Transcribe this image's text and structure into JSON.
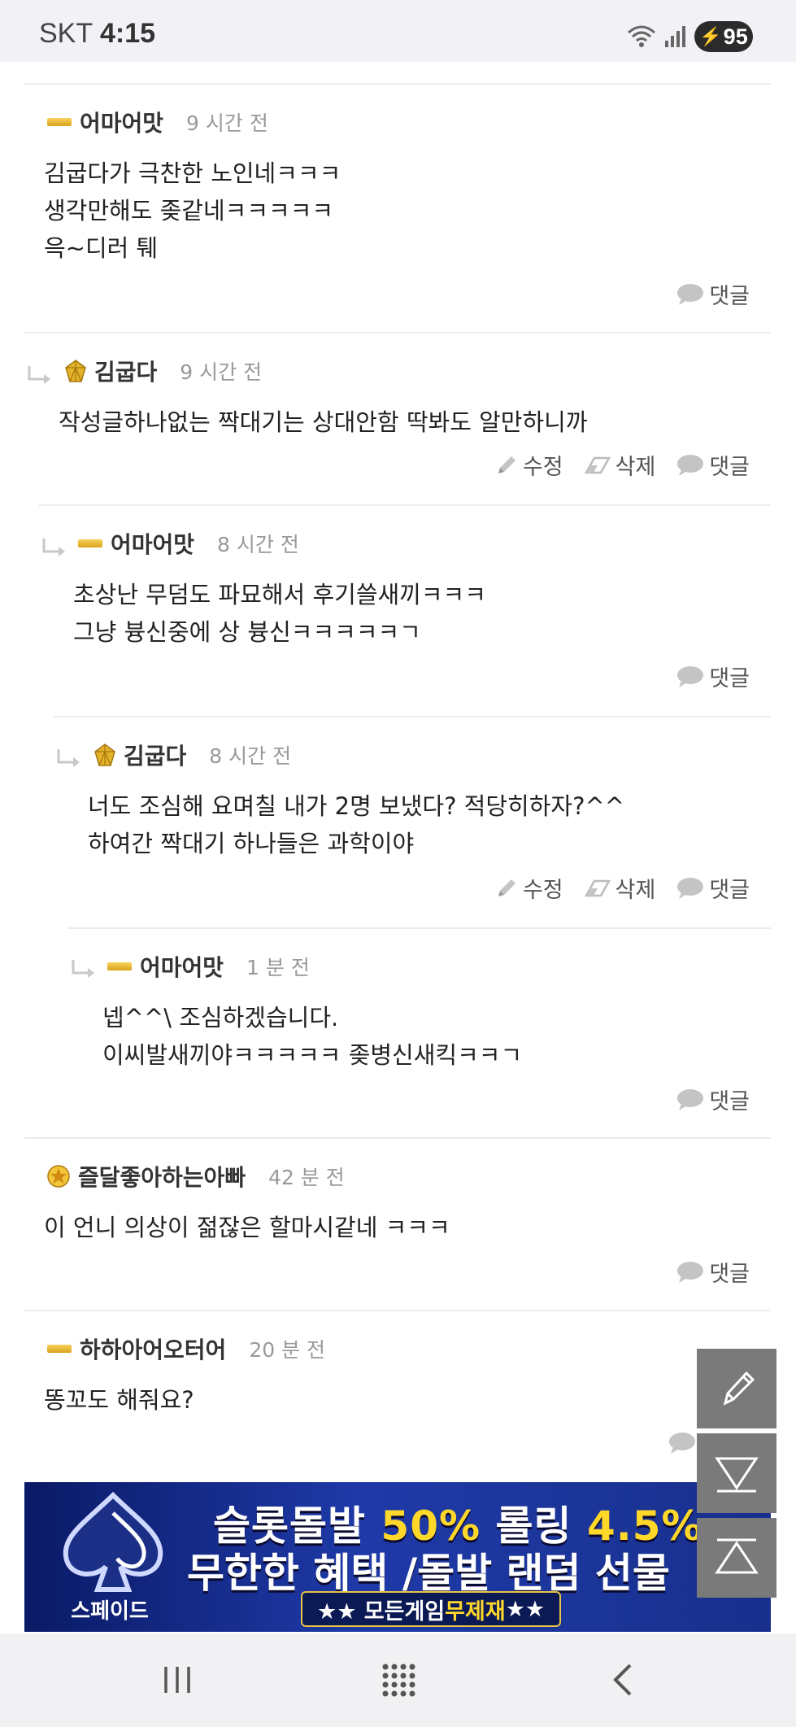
{
  "status_bar": {
    "carrier": "SKT",
    "time": "4:15",
    "battery": "95"
  },
  "comments": [
    {
      "nick": "어마어맛",
      "level_icon": "gold-bar-icon",
      "time": "9 시간 전",
      "lines": [
        "김굽다가 극찬한 노인네ㅋㅋㅋ",
        "생각만해도 좆같네ㅋㅋㅋㅋㅋ",
        "윽~디러 퉤"
      ],
      "actions": {
        "reply": "댓글"
      }
    },
    {
      "nick": "김굽다",
      "level_icon": "gold-gem-icon",
      "time": "9 시간 전",
      "lines": [
        "작성글하나없는 짝대기는 상대안함 딱봐도 알만하니까"
      ],
      "actions": {
        "edit": "수정",
        "delete": "삭제",
        "reply": "댓글"
      }
    },
    {
      "nick": "어마어맛",
      "level_icon": "gold-bar-icon",
      "time": "8 시간 전",
      "lines": [
        "초상난 무덤도 파묘해서 후기쓸새끼ㅋㅋㅋ",
        "그냥 븅신중에 상 븅신ㅋㅋㅋㅋㅋㄱ"
      ],
      "actions": {
        "reply": "댓글"
      }
    },
    {
      "nick": "김굽다",
      "level_icon": "gold-gem-icon",
      "time": "8 시간 전",
      "lines": [
        "너도 조심해 요며칠 내가 2명 보냈다? 적당히하자?^^",
        "하여간 짝대기 하나들은 과학이야"
      ],
      "actions": {
        "edit": "수정",
        "delete": "삭제",
        "reply": "댓글"
      }
    },
    {
      "nick": "어마어맛",
      "level_icon": "gold-bar-icon",
      "time": "1 분 전",
      "lines": [
        "넵^^\\ 조심하겠습니다.",
        "이씨발새끼야ㅋㅋㅋㅋㅋ 좆병신새킥ㅋㅋㄱ"
      ],
      "actions": {
        "reply": "댓글"
      }
    },
    {
      "nick": "즐달좋아하는아빠",
      "level_icon": "gold-star-icon",
      "time": "42 분 전",
      "lines": [
        "이 언니 의상이 젊잖은 할마시같네 ㅋㅋㅋ"
      ],
      "actions": {
        "reply": "댓글"
      }
    },
    {
      "nick": "하하아어오터어",
      "level_icon": "gold-bar-icon",
      "time": "20 분 전",
      "lines": [
        "똥꼬도 해줘요?"
      ],
      "actions": {}
    }
  ],
  "ad": {
    "brand": "스페이드",
    "line1_a": "슬롯돌발 ",
    "line1_b": "50%",
    "line1_c": " 롤링 ",
    "line1_d": "4.5%",
    "line2": "무한한 혜택 /돌발 랜덤 선물",
    "strip_a": "★★ 모든게임 ",
    "strip_b": "무제재",
    "strip_c": " ★★"
  },
  "floating_buttons": [
    "pencil-icon",
    "scroll-down-icon",
    "scroll-top-icon"
  ],
  "nav": [
    "recent-apps-icon",
    "home-icon",
    "back-icon"
  ],
  "colors": {
    "accent_gold": "#e3b22a",
    "fab_bg": "#7a7a7a"
  }
}
